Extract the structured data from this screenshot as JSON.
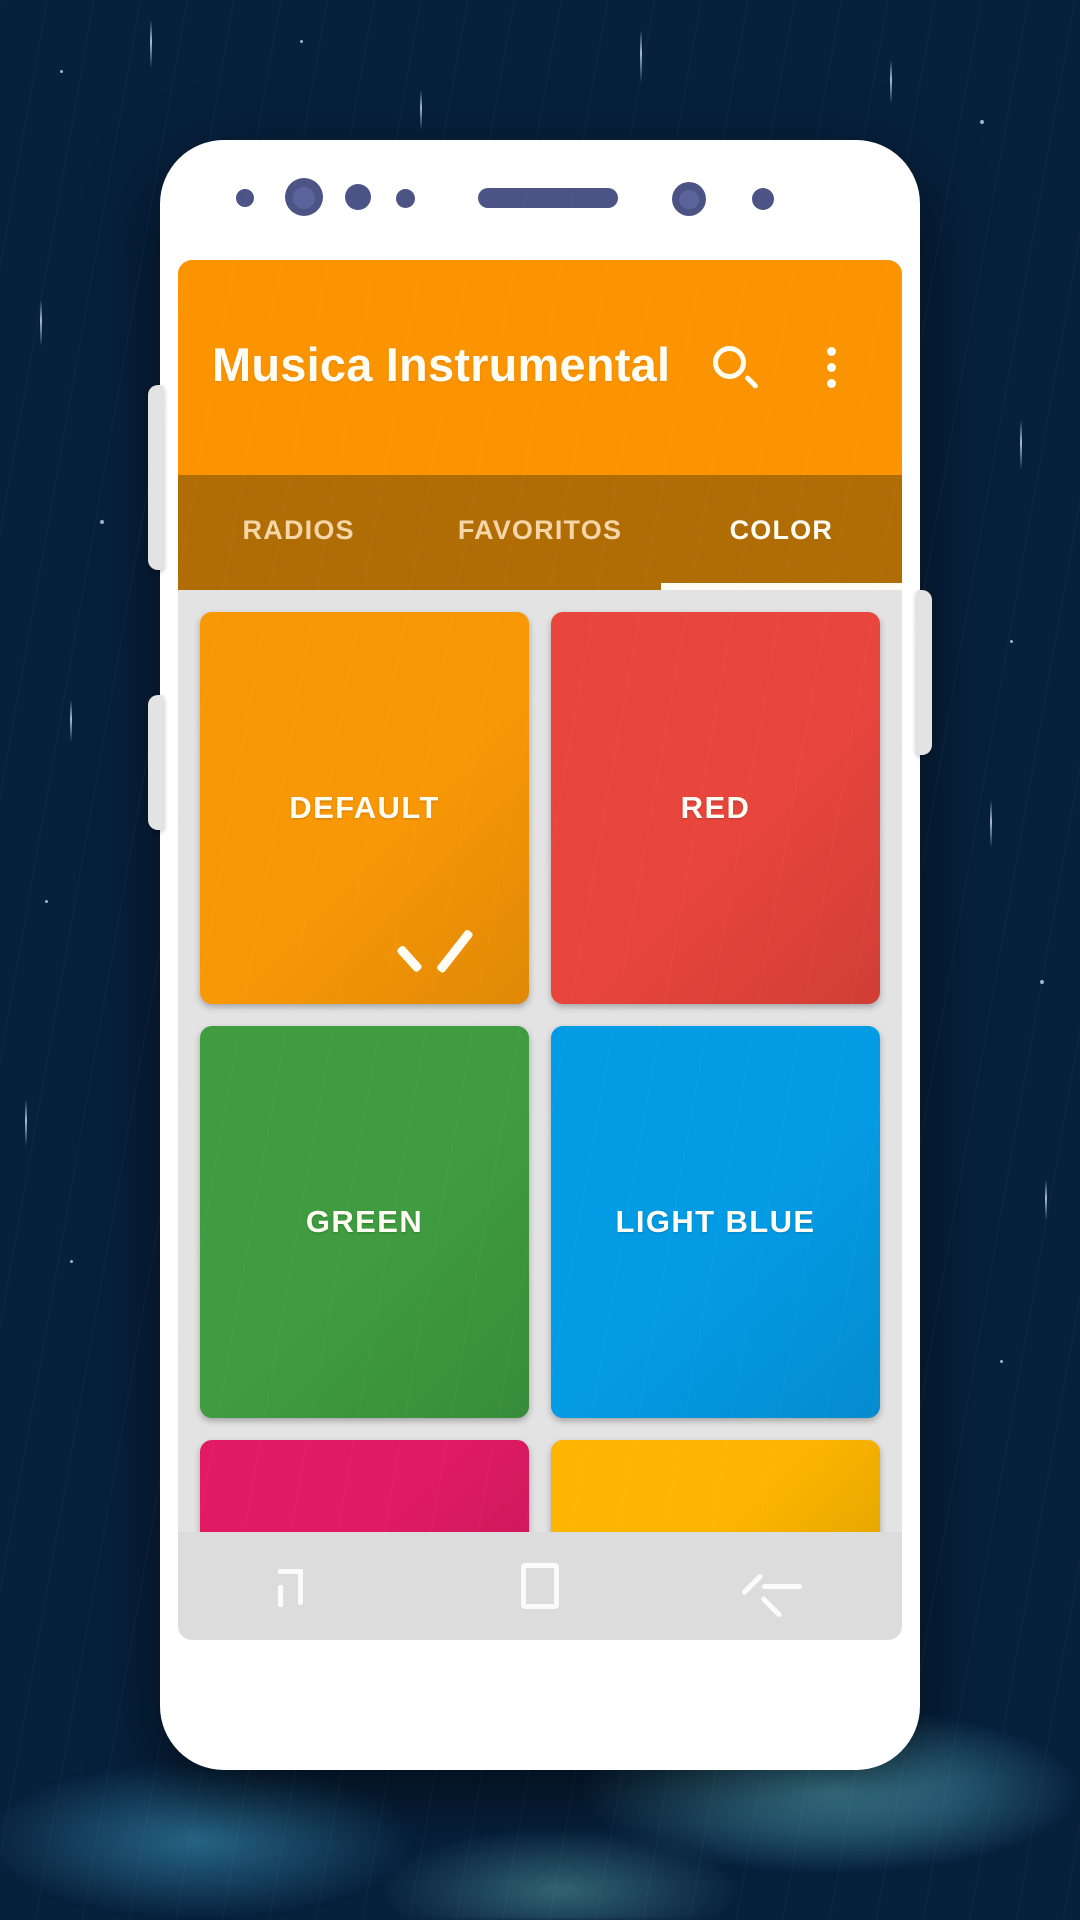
{
  "app": {
    "title": "Musica Instrumental",
    "appbar_color": "#fb9400",
    "tabbar_color": "#b06c05",
    "search_icon": "search-icon",
    "overflow_icon": "more-vert-icon"
  },
  "tabs": [
    {
      "label": "RADIOS",
      "active": false
    },
    {
      "label": "FAVORITOS",
      "active": false
    },
    {
      "label": "COLOR",
      "active": true
    }
  ],
  "color_grid": {
    "tiles": [
      {
        "label": "DEFAULT",
        "color": "#f99806",
        "selected": true,
        "partial": false
      },
      {
        "label": "RED",
        "color": "#e8453c",
        "selected": false,
        "partial": false
      },
      {
        "label": "GREEN",
        "color": "#3f9c40",
        "selected": false,
        "partial": false
      },
      {
        "label": "LIGHT BLUE",
        "color": "#049be5",
        "selected": false,
        "partial": false
      },
      {
        "label": "",
        "color": "#e01b63",
        "selected": false,
        "partial": true
      },
      {
        "label": "",
        "color": "#fcb500",
        "selected": false,
        "partial": true
      }
    ],
    "background": "#e3e3e3",
    "check_icon": "check-icon"
  },
  "navbar": {
    "recent_label": "recent-apps-icon",
    "home_label": "home-icon",
    "back_label": "back-icon"
  },
  "device": {
    "body_color": "#ffffff",
    "sensor_color": "#4c5485"
  }
}
